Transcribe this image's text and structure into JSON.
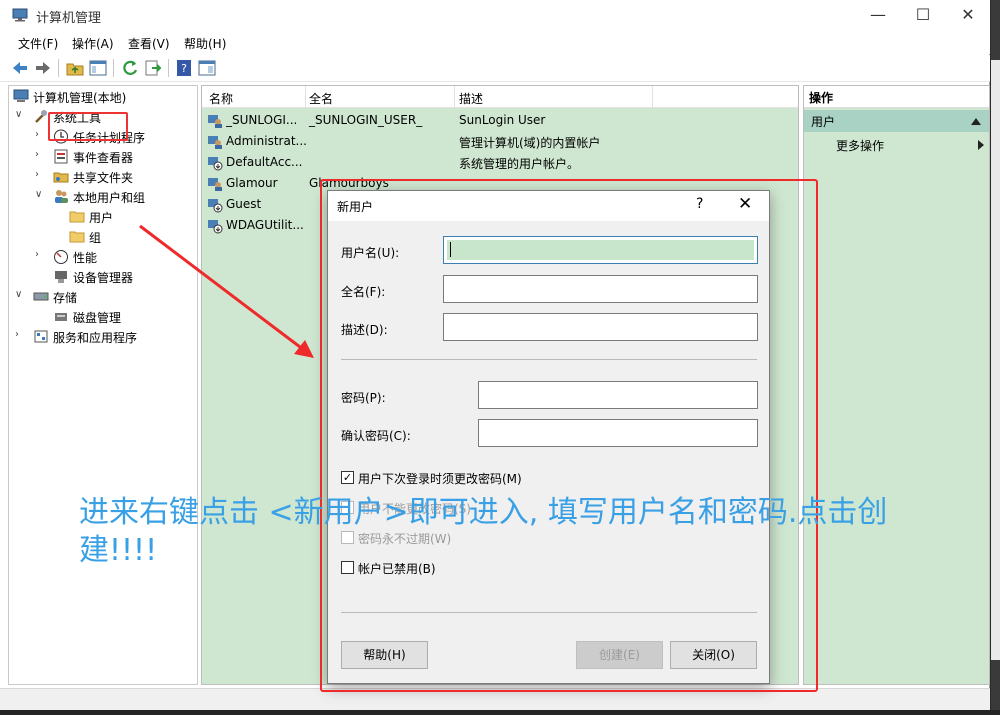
{
  "window": {
    "title": "计算机管理"
  },
  "menu": [
    "文件(F)",
    "操作(A)",
    "查看(V)",
    "帮助(H)"
  ],
  "tree": {
    "root": "计算机管理(本地)",
    "system_tools": "系统工具",
    "task_scheduler": "任务计划程序",
    "event_viewer": "事件查看器",
    "shared_folders": "共享文件夹",
    "local_users_groups": "本地用户和组",
    "users": "用户",
    "groups": "组",
    "performance": "性能",
    "device_manager": "设备管理器",
    "storage": "存储",
    "disk_management": "磁盘管理",
    "services_apps": "服务和应用程序"
  },
  "list": {
    "headers": [
      "名称",
      "全名",
      "描述"
    ],
    "rows": [
      {
        "name": "_SUNLOGI...",
        "full": "_SUNLOGIN_USER_",
        "desc": "SunLogin User"
      },
      {
        "name": "Administrat...",
        "full": "",
        "desc": "管理计算机(域)的内置帐户"
      },
      {
        "name": "DefaultAcc...",
        "full": "",
        "desc": "系统管理的用户帐户。"
      },
      {
        "name": "Glamour",
        "full": "Glamourboys",
        "desc": ""
      },
      {
        "name": "Guest",
        "full": "",
        "desc": ""
      },
      {
        "name": "WDAGUtilit...",
        "full": "",
        "desc": ""
      }
    ]
  },
  "actions": {
    "header": "操作",
    "section": "用户",
    "more": "更多操作"
  },
  "dialog": {
    "title": "新用户",
    "help_glyph": "?",
    "close_glyph": "✕",
    "username_label": "用户名(U):",
    "fullname_label": "全名(F):",
    "desc_label": "描述(D):",
    "password_label": "密码(P):",
    "confirm_label": "确认密码(C):",
    "chk_must_change": "用户下次登录时须更改密码(M)",
    "chk_cannot_change": "用户不能更改密码(S)",
    "chk_never_expire": "密码永不过期(W)",
    "chk_disabled": "帐户已禁用(B)",
    "btn_help": "帮助(H)",
    "btn_create": "创建(E)",
    "btn_close": "关闭(O)"
  },
  "annotation": "进来右键点击 <新用户>即可进入, 填写用户名和密码.点击创建!!!!",
  "colors": {
    "annotation": "#3aa0e6",
    "highlight": "#ee2a2a",
    "list_bg": "#cfe7d1"
  }
}
